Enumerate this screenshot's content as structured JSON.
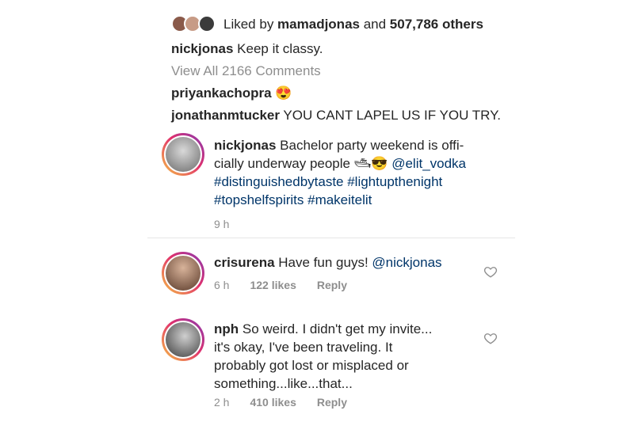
{
  "likes": {
    "prefix": "Liked by ",
    "user": "mamadjonas",
    "middle": " and ",
    "count": "507,786 others"
  },
  "top_caption": {
    "user": "nickjonas",
    "text": " Keep it classy."
  },
  "view_all": "View All 2166 Comments",
  "top_comments": [
    {
      "user": "priyankachopra",
      "text": " 😍"
    },
    {
      "user": "jonathanmtucker",
      "text": " YOU CANT LAPEL US IF YOU TRY."
    }
  ],
  "post": {
    "user": "nickjonas",
    "text_line1": " Bachelor party weekend is offi-",
    "text_line2": "cially underway people ",
    "emoji": "🛥😎 ",
    "mention": "@elit_vodka",
    "tags_line3": "#distinguishedbytaste #lightupthenight",
    "tags_line4": "#topshelfspirits #makeitelit",
    "time": "9 h"
  },
  "comments": [
    {
      "user": "crisurena",
      "text": " Have fun guys! ",
      "mention": "@nickjonas",
      "time": "6 h",
      "likes": "122 likes",
      "reply": "Reply"
    },
    {
      "user": "nph",
      "line1": " So weird. I didn't get my invite...",
      "line2": "it's okay, I've been traveling. It",
      "line3": "probably got lost or misplaced or",
      "line4": "something...like...that...",
      "time": "2 h",
      "likes": "410 likes",
      "reply": "Reply"
    }
  ],
  "colors": {
    "hashtag": "#003569",
    "muted": "#8e8e8e",
    "text": "#262626"
  }
}
